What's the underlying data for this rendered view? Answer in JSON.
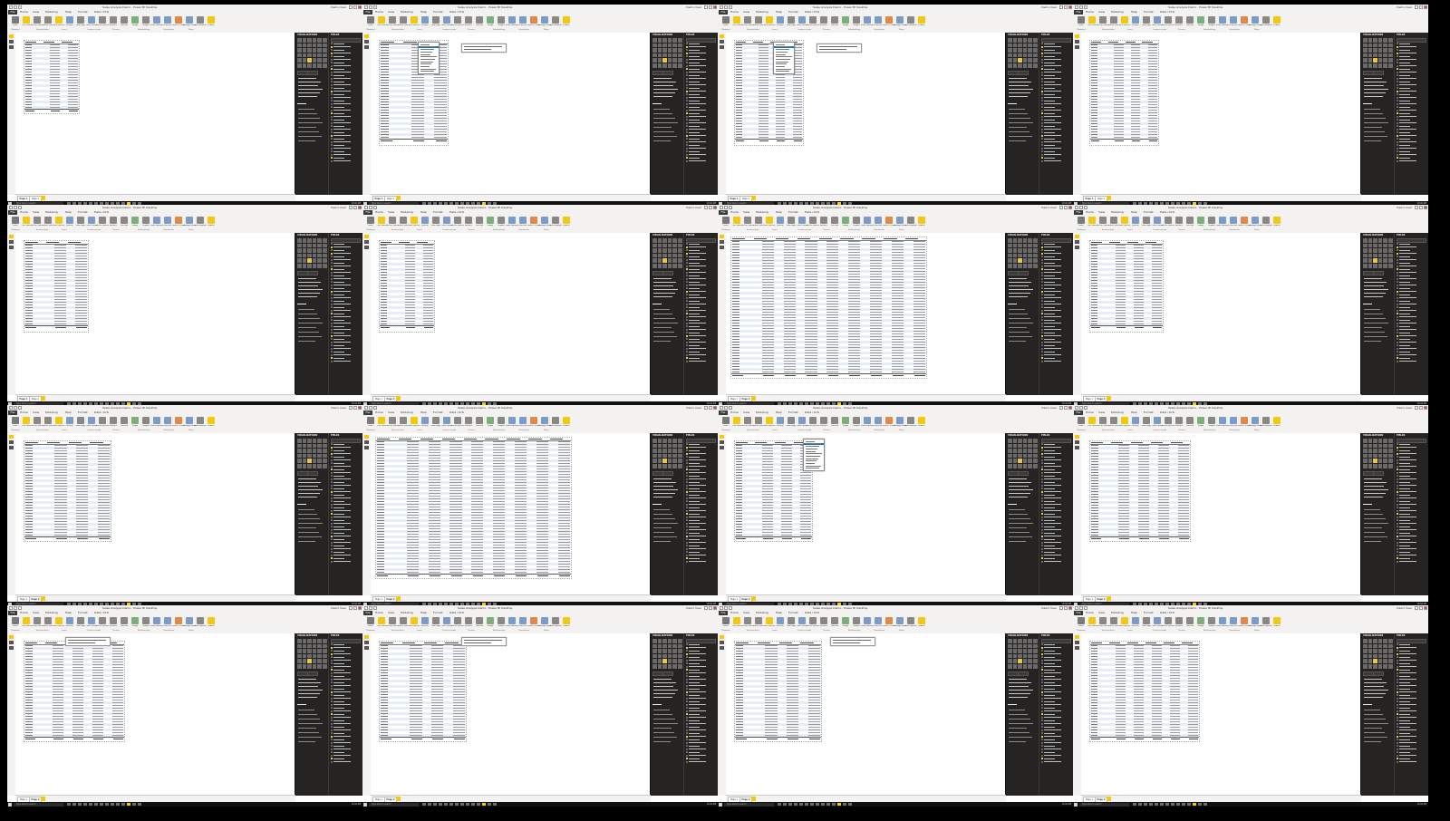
{
  "window": {
    "title": "Sales Analysis Demo - Power BI Desktop",
    "user_name": "Demo User"
  },
  "menu": {
    "file_label": "File",
    "items": [
      "Home",
      "View",
      "Modeling",
      "Help",
      "Format",
      "Data / Drill"
    ]
  },
  "ribbon": {
    "buttons": [
      {
        "label": "Paste",
        "color": "#7a7a7a"
      },
      {
        "label": "Get Data",
        "color": "#f2c811"
      },
      {
        "label": "Recent Sources",
        "color": "#8a8886"
      },
      {
        "label": "Enter Data",
        "color": "#8a8886"
      },
      {
        "label": "Edit Queries",
        "color": "#f2c811"
      },
      {
        "label": "Refresh",
        "color": "#7a9cc6"
      },
      {
        "label": "New Page",
        "color": "#8a8886"
      },
      {
        "label": "New Visual",
        "color": "#7a9cc6"
      },
      {
        "label": "Ask A Question",
        "color": "#8a8886"
      },
      {
        "label": "Buttons",
        "color": "#8a8886"
      },
      {
        "label": "Text box",
        "color": "#8a8886"
      },
      {
        "label": "Image",
        "color": "#7ab07a"
      },
      {
        "label": "Shapes",
        "color": "#8a8886"
      },
      {
        "label": "From Marketplace",
        "color": "#7a9cc6"
      },
      {
        "label": "From File",
        "color": "#7a9cc6"
      },
      {
        "label": "Switch Theme",
        "color": "#e08a4a"
      },
      {
        "label": "Manage Relationships",
        "color": "#7a9cc6"
      },
      {
        "label": "New Measure",
        "color": "#8a8886"
      },
      {
        "label": "Publish",
        "color": "#f2c811"
      }
    ],
    "groups": [
      "Clipboard",
      "External data",
      "Insert",
      "Custom visuals",
      "Themes",
      "Relationships",
      "Calculations",
      "Share"
    ]
  },
  "panes": {
    "visualizations_title": "VISUALIZATIONS",
    "fields_title": "FIELDS"
  },
  "pages": [
    "Page 1",
    "Page 2"
  ],
  "taskbar": {
    "search_placeholder": "Type here to search",
    "clock": "10:42 AM"
  }
}
